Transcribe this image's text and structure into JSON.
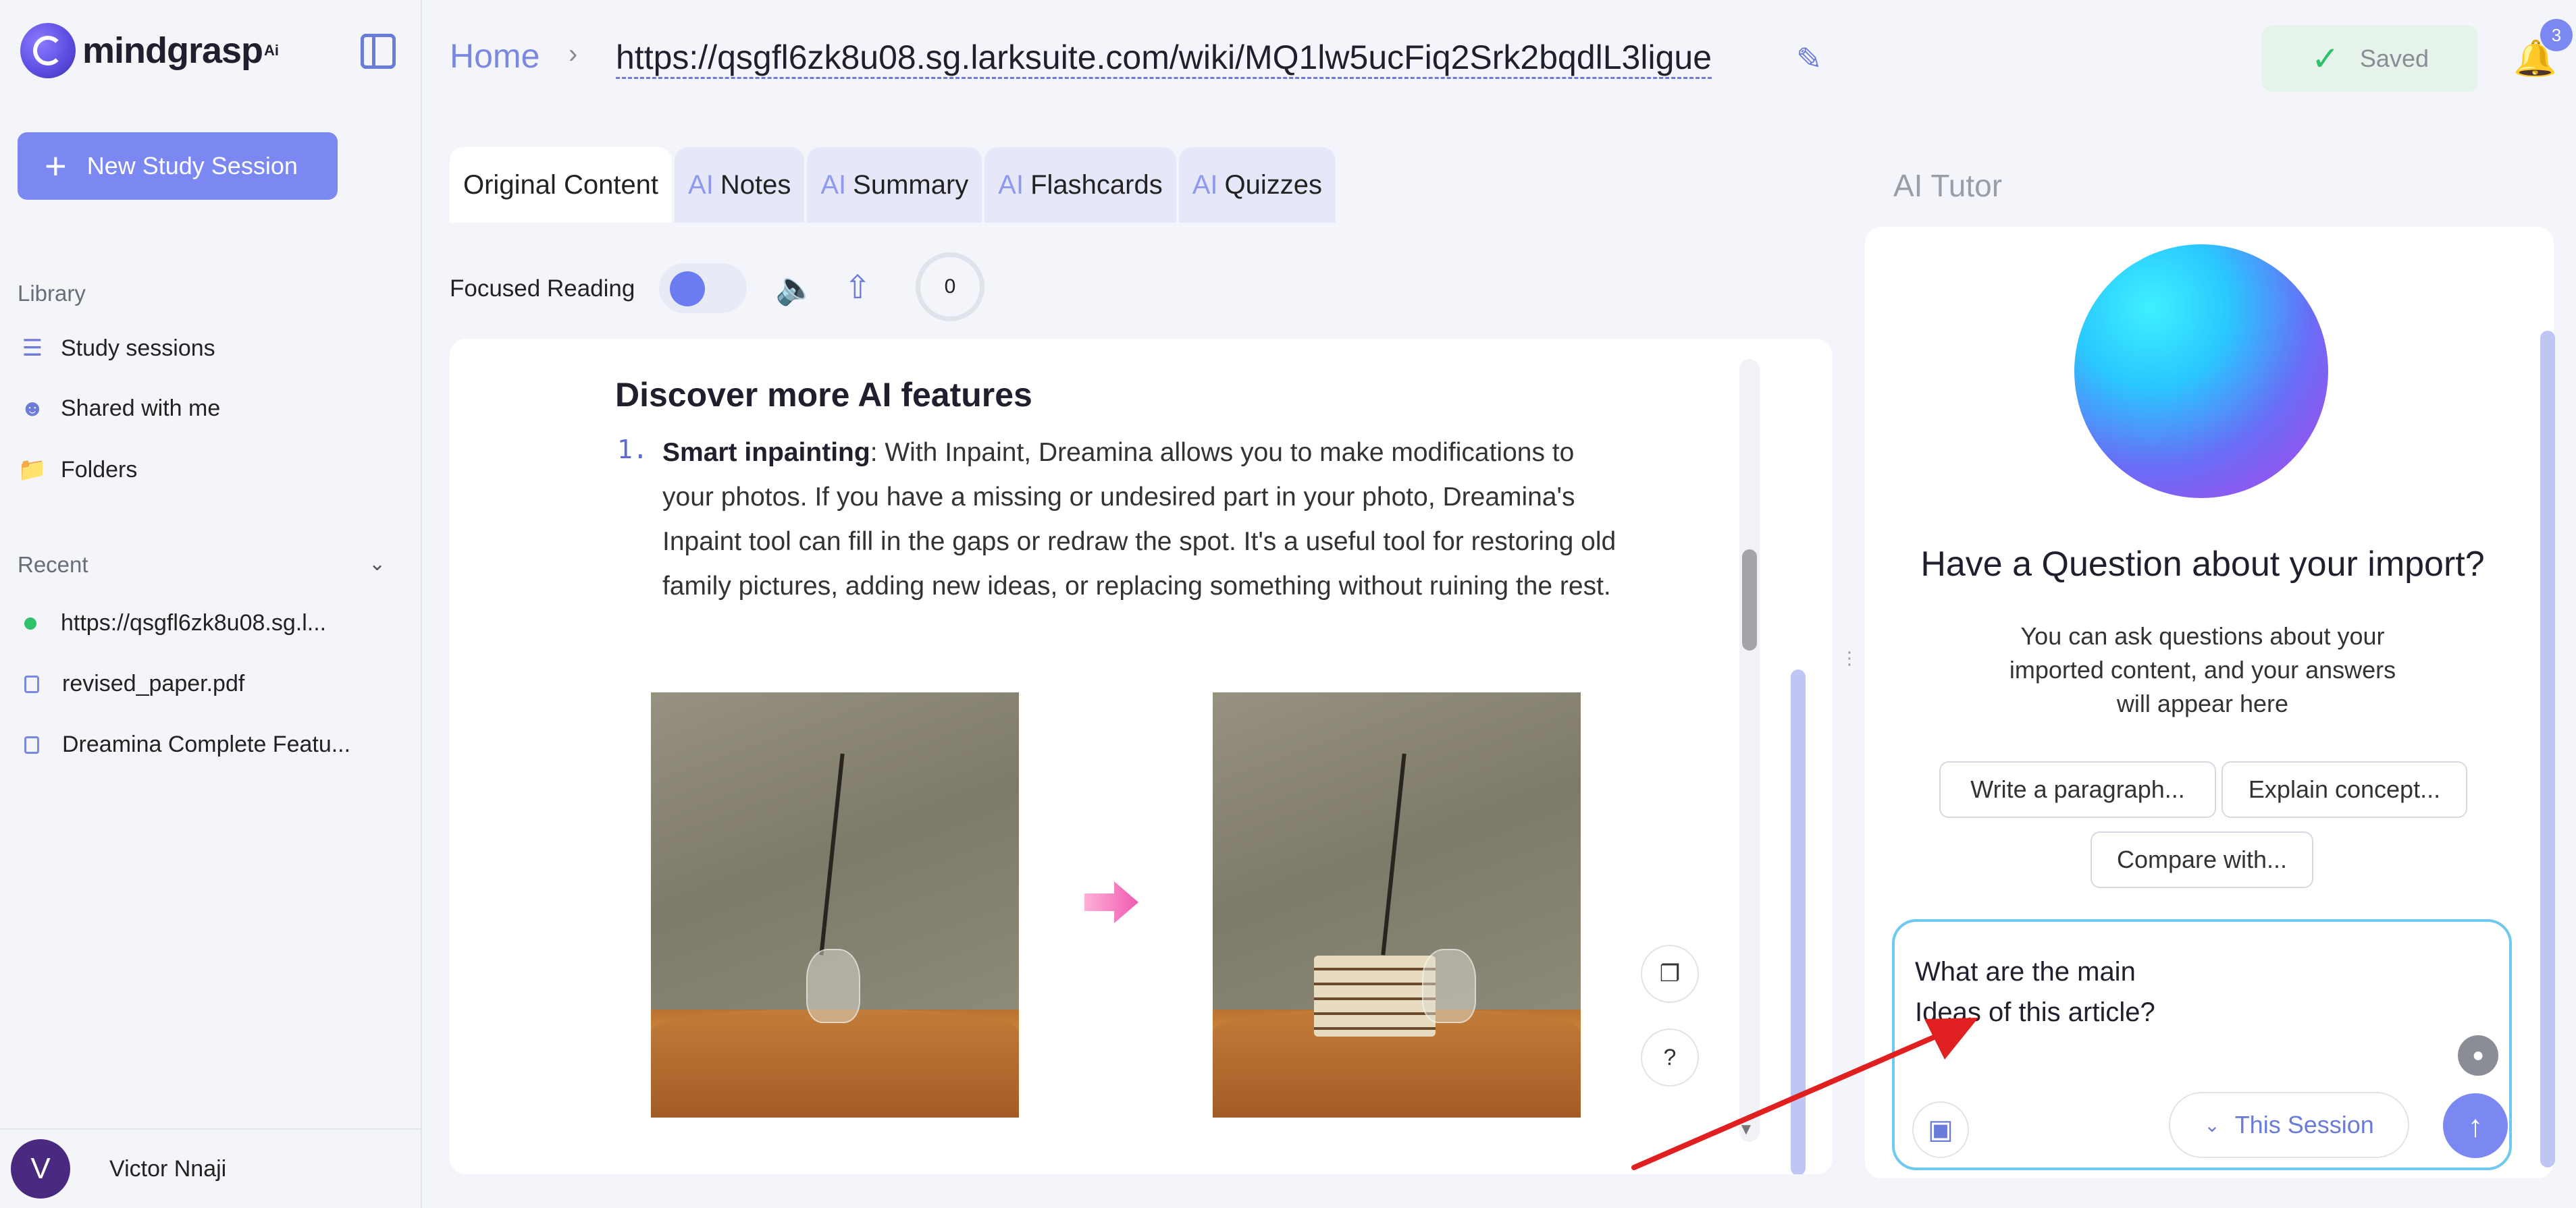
{
  "app": {
    "logo_text": "mindgrasp",
    "logo_sup": "Ai"
  },
  "sidebar": {
    "new_session_label": "New Study Session",
    "library_label": "Library",
    "library_items": [
      {
        "label": "Study sessions",
        "icon": "library-icon"
      },
      {
        "label": "Shared with me",
        "icon": "users-icon"
      },
      {
        "label": "Folders",
        "icon": "folder-icon"
      }
    ],
    "recent_label": "Recent",
    "recent_items": [
      {
        "label": "https://qsgfl6zk8u08.sg.l...",
        "icon": "status-dot"
      },
      {
        "label": "revised_paper.pdf",
        "icon": "document-icon"
      },
      {
        "label": "Dreamina Complete Featu...",
        "icon": "document-icon"
      }
    ],
    "user": {
      "initial": "V",
      "name": "Victor Nnaji"
    }
  },
  "header": {
    "home_label": "Home",
    "url": "https://qsgfl6zk8u08.sg.larksuite.com/wiki/MQ1lw5ucFiq2Srk2bqdlL3ligue",
    "saved_label": "Saved",
    "notification_count": "3"
  },
  "tabs": [
    {
      "prefix": "",
      "label": "Original Content",
      "active": true
    },
    {
      "prefix": "AI",
      "label": "Notes"
    },
    {
      "prefix": "AI",
      "label": "Summary"
    },
    {
      "prefix": "AI",
      "label": "Flashcards"
    },
    {
      "prefix": "AI",
      "label": "Quizzes"
    }
  ],
  "toolbar": {
    "focused_reading_label": "Focused Reading",
    "progress_value": "0"
  },
  "content": {
    "heading": "Discover more AI features",
    "item_number": "1.",
    "item_title": "Smart inpainting",
    "item_text": ": With Inpaint, Dreamina allows you to make modifications to your photos. If you have a missing or undesired part in your photo, Dreamina's Inpaint tool can fill in the gaps or redraw the spot. It's a useful tool for restoring old family pictures, adding new ideas, or replacing something without ruining the rest."
  },
  "tutor": {
    "title": "AI Tutor",
    "question": "Have a Question about your import?",
    "description": "You can ask questions about your imported content, and your answers will appear here",
    "chips": [
      "Write a paragraph...",
      "Explain concept...",
      "Compare with..."
    ],
    "input_value": "What are the main\nIdeas of this article?",
    "session_label": "This Session"
  },
  "colors": {
    "accent": "#7b88f2",
    "success": "#2ec26a",
    "annotation_arrow": "#e02020"
  }
}
